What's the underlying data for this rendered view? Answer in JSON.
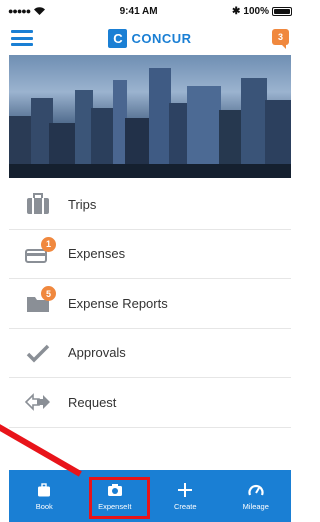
{
  "status_bar": {
    "signal": "●●●●●",
    "time": "9:41 AM",
    "bluetooth": "✱",
    "battery": "100%",
    "battery_level": 1.0
  },
  "header": {
    "logo_mark": "C",
    "logo_text": "CONCUR",
    "notification_count": "3",
    "menu_icon": "hamburger-icon",
    "notification_icon": "chat-bubble-icon"
  },
  "menu": {
    "items": [
      {
        "label": "Trips",
        "icon": "suitcase-icon",
        "badge": ""
      },
      {
        "label": "Expenses",
        "icon": "card-icon",
        "badge": "1"
      },
      {
        "label": "Expense Reports",
        "icon": "folder-icon",
        "badge": "5"
      },
      {
        "label": "Approvals",
        "icon": "checkmark-icon",
        "badge": ""
      },
      {
        "label": "Request",
        "icon": "arrows-icon",
        "badge": ""
      }
    ]
  },
  "tab_bar": {
    "tabs": [
      {
        "label": "Book",
        "icon": "suitcase-icon"
      },
      {
        "label": "ExpenseIt",
        "icon": "camera-icon"
      },
      {
        "label": "Create",
        "icon": "plus-icon"
      },
      {
        "label": "Mileage",
        "icon": "speedometer-icon"
      }
    ]
  },
  "colors": {
    "accent": "#1a7fd4",
    "badge": "#f0883e",
    "annotation": "#e8141a"
  }
}
